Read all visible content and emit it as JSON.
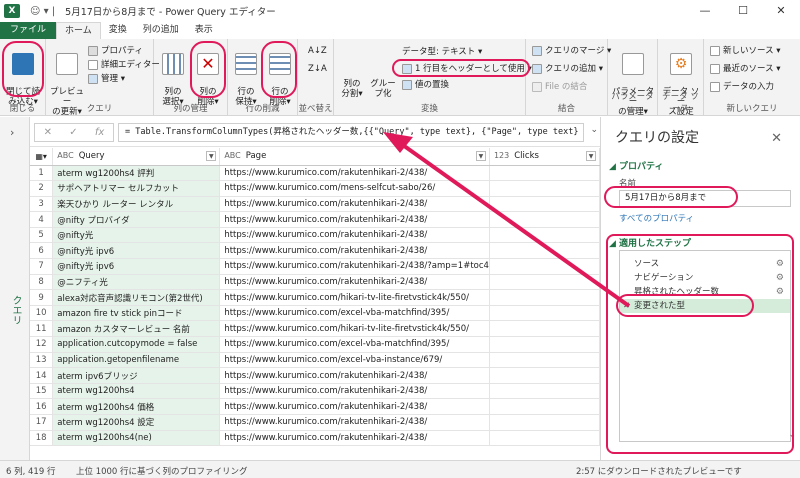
{
  "window": {
    "app_badge": "X",
    "quick_access": "☺ ▾ | ",
    "title": "5月17日から8月まで - Power Query エディター",
    "min": "—",
    "max": "☐",
    "close": "✕"
  },
  "tabs": [
    "ファイル",
    "ホーム",
    "変換",
    "列の追加",
    "表示"
  ],
  "ribbon": {
    "close_load": "閉じて読\nみ込む▾",
    "preview_refresh": "プレビュー\nの更新▾",
    "properties": "プロパティ",
    "advanced_editor": "詳細エディター",
    "manage": "管理 ▾",
    "choose_cols": "列の\n選択▾",
    "remove_cols": "列の\n削除▾",
    "keep_rows": "行の\n保持▾",
    "remove_rows": "行の\n削除▾",
    "sort_asc": "A↓Z",
    "sort_desc": "Z↓A",
    "split_col": "列の\n分割▾",
    "group_by": "グルー\nプ化",
    "data_type": "データ型: テキスト ▾",
    "use_first_row": "1 行目をヘッダーとして使用 ▾",
    "replace_values": "値の置換",
    "merge_queries": "クエリのマージ ▾",
    "append_queries": "クエリの追加 ▾",
    "combine_files": "File の結合",
    "parameters": "パラメーター\nの管理▾",
    "data_source": "データ ソー\nス設定",
    "new_source": "新しいソース ▾",
    "recent_sources": "最近のソース ▾",
    "enter_data": "データの入力",
    "groups": {
      "close": "閉じる",
      "query": "クエリ",
      "manage_cols": "列の管理",
      "reduce_rows": "行の削減",
      "sort": "並べ替え",
      "transform": "変換",
      "combine": "結合",
      "parameters": "パラメーター",
      "data_source": "データ ソース",
      "new_query": "新しいクエリ"
    }
  },
  "left_rail": {
    "chevron": "›",
    "label": "クエリ"
  },
  "formula_bar": {
    "cancel": "✕",
    "accept": "✓",
    "fx": "fx",
    "text": "= Table.TransformColumnTypes(昇格されたヘッダー数,{{\"Query\", type text}, {\"Page\", type text}",
    "expand": "⌄"
  },
  "grid": {
    "columns": [
      {
        "type": "ABC",
        "name": "Query"
      },
      {
        "type": "ABC",
        "name": "Page"
      },
      {
        "type": "123",
        "name": "Clicks"
      }
    ],
    "rows": [
      [
        "aterm wg1200hs4 評判",
        "https://www.kurumico.com/rakutenhikari-2/438/"
      ],
      [
        "サポヘアトリマー セルフカット",
        "https://www.kurumico.com/mens-selfcut-sabo/26/"
      ],
      [
        "楽天ひかり ルーター レンタル",
        "https://www.kurumico.com/rakutenhikari-2/438/"
      ],
      [
        "@nifty プロバイダ",
        "https://www.kurumico.com/rakutenhikari-2/438/"
      ],
      [
        "@nifty光",
        "https://www.kurumico.com/rakutenhikari-2/438/"
      ],
      [
        "@nifty光 ipv6",
        "https://www.kurumico.com/rakutenhikari-2/438/"
      ],
      [
        "@nifty光 ipv6",
        "https://www.kurumico.com/rakutenhikari-2/438/?amp=1#toc4"
      ],
      [
        "@ニフティ光",
        "https://www.kurumico.com/rakutenhikari-2/438/"
      ],
      [
        "alexa対応音声認識リモコン(第2世代)",
        "https://www.kurumico.com/hikari-tv-lite-firetvstick4k/550/"
      ],
      [
        "amazon fire tv stick pinコード",
        "https://www.kurumico.com/excel-vba-matchfind/395/"
      ],
      [
        "amazon カスタマーレビュー 名前",
        "https://www.kurumico.com/hikari-tv-lite-firetvstick4k/550/"
      ],
      [
        "application.cutcopymode = false",
        "https://www.kurumico.com/excel-vba-matchfind/395/"
      ],
      [
        "application.getopenfilename",
        "https://www.kurumico.com/excel-vba-instance/679/"
      ],
      [
        "aterm ipv6ブリッジ",
        "https://www.kurumico.com/rakutenhikari-2/438/"
      ],
      [
        "aterm wg1200hs4",
        "https://www.kurumico.com/rakutenhikari-2/438/"
      ],
      [
        "aterm wg1200hs4 価格",
        "https://www.kurumico.com/rakutenhikari-2/438/"
      ],
      [
        "aterm wg1200hs4 設定",
        "https://www.kurumico.com/rakutenhikari-2/438/"
      ],
      [
        "aterm wg1200hs4(ne)",
        "https://www.kurumico.com/rakutenhikari-2/438/"
      ]
    ]
  },
  "settings": {
    "title": "クエリの設定",
    "close": "✕",
    "properties_header": "◢ プロパティ",
    "name_label": "名前",
    "name_value": "5月17日から8月まで",
    "all_properties": "すべてのプロパティ",
    "steps_header": "◢ 適用したステップ",
    "steps": [
      "ソース",
      "ナビゲーション",
      "昇格されたヘッダー数",
      "変更された型"
    ],
    "gear": "⚙",
    "delete": "✕",
    "scroll_down": "⌄"
  },
  "status": {
    "counts": "6 列, 419 行",
    "profiling": "上位 1000 行に基づく列のプロファイリング",
    "download": "2:57 にダウンロードされたプレビューです"
  },
  "colors": {
    "excel_green": "#217346",
    "annotation": "#e0195a",
    "query_col_bg": "#e6f3ea"
  }
}
